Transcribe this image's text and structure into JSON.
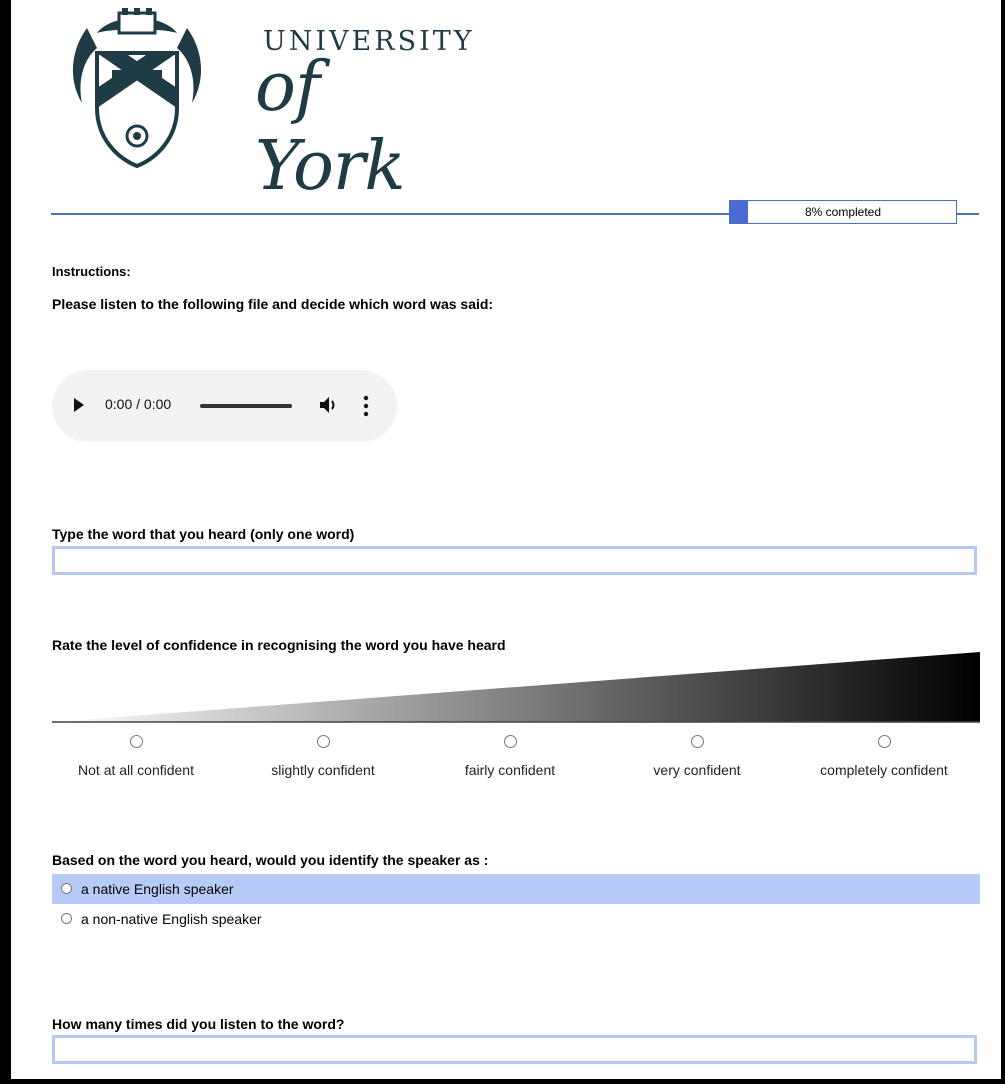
{
  "logo": {
    "line1": "UNIVERSITY",
    "line2": "of York",
    "crest_icon": "university-crest-icon"
  },
  "progress": {
    "percent": 8,
    "label": "8% completed",
    "color": "#4a6ad6"
  },
  "instructions": {
    "heading": "Instructions:",
    "text": "Please listen to the following file and decide which word was said:"
  },
  "audio": {
    "time": "0:00 / 0:00"
  },
  "q_word": {
    "label": "Type the word that you heard (only one word)",
    "value": ""
  },
  "q_confidence": {
    "label": "Rate the level of confidence in recognising the word you have heard",
    "options": [
      "Not at all confident",
      "slightly confident",
      "fairly confident",
      "very confident",
      "completely confident"
    ]
  },
  "q_speaker": {
    "label": "Based on the word you heard, would you identify the speaker as :",
    "options": [
      "a native English speaker",
      "a non-native English speaker"
    ],
    "highlight_color": "#b7cbf8"
  },
  "q_times": {
    "label": "How many times did you listen to the word?",
    "value": ""
  }
}
